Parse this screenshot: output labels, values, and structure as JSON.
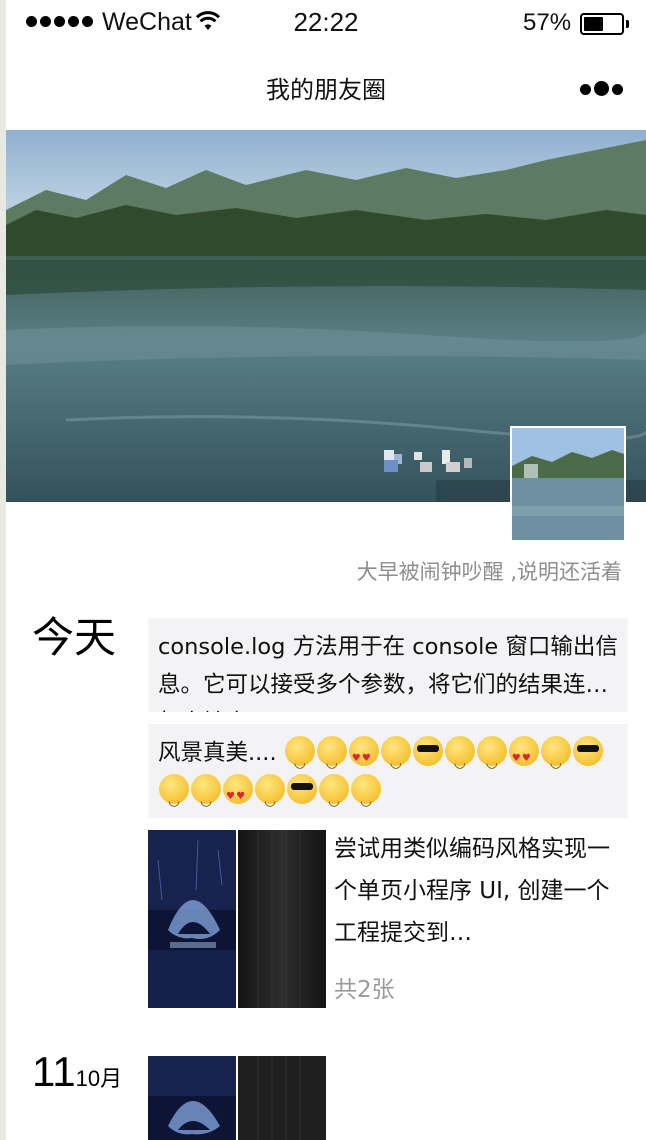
{
  "status_bar": {
    "carrier": "WeChat",
    "time": "22:22",
    "battery_percent": "57%",
    "battery_level": 0.57
  },
  "nav": {
    "title": "我的朋友圈"
  },
  "profile": {
    "signature": "大早被闹钟吵醒 ,说明还活着"
  },
  "feed": {
    "today_label": "今天",
    "post1": {
      "text": "console.log 方法用于在 console 窗口输出信息。它可以接受多个参数，将它们的结果连接起来输出。"
    },
    "post2": {
      "text": "风景真美....",
      "emojis": [
        "smile",
        "dizzy",
        "heart",
        "confused",
        "cool",
        "smile",
        "dizzy",
        "heart",
        "confused",
        "cool",
        "smile",
        "dizzy",
        "heart",
        "confused",
        "cool",
        "smile",
        "dizzy"
      ]
    },
    "post3": {
      "text": "尝试用类似编码风格实现一个单页小程序 UI, 创建一个工程提交到…",
      "count": "共2张"
    },
    "day2": {
      "day": "11",
      "month": "10月"
    }
  }
}
